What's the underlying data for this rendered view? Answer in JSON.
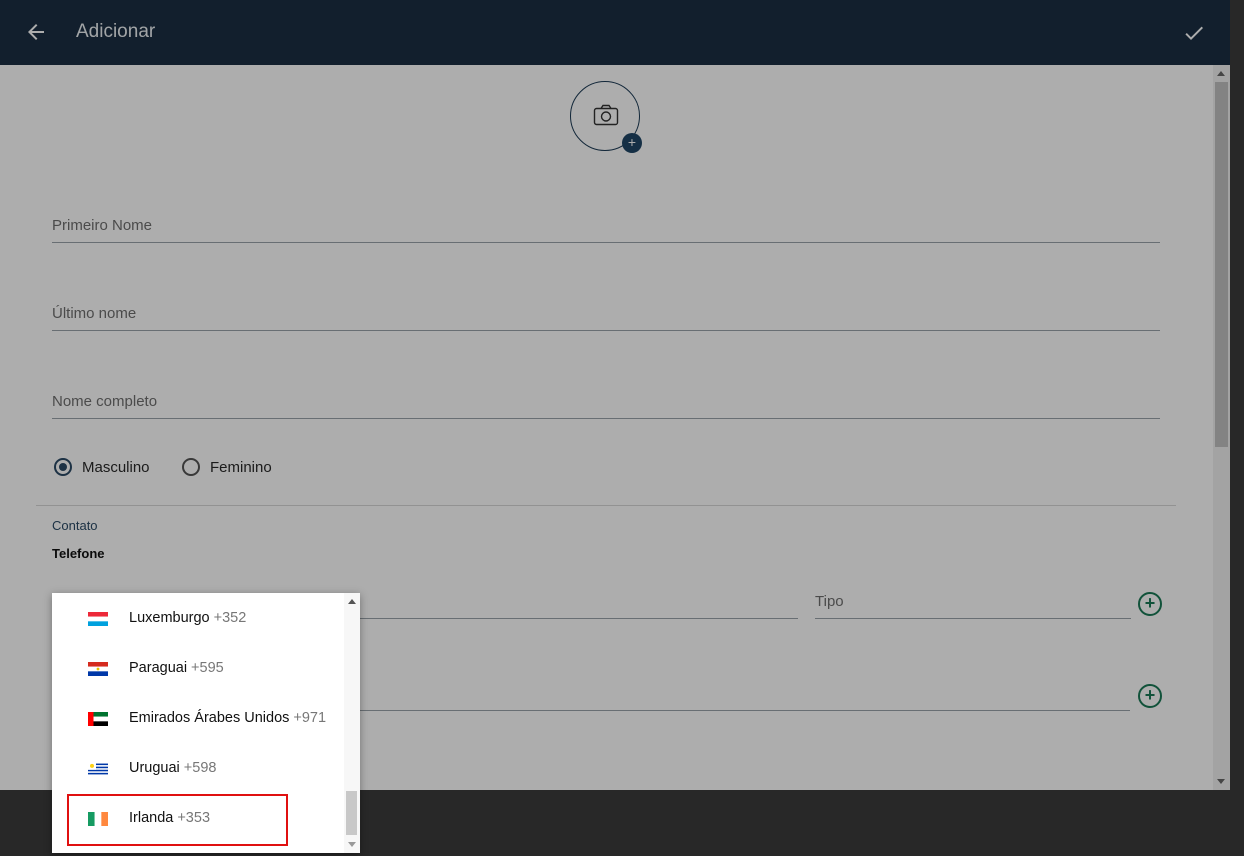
{
  "appbar": {
    "title": "Adicionar"
  },
  "form": {
    "first_name_placeholder": "Primeiro Nome",
    "last_name_placeholder": "Último nome",
    "full_name_placeholder": "Nome completo",
    "gender": {
      "male_label": "Masculino",
      "female_label": "Feminino",
      "selected": "Masculino"
    },
    "contact_section": "Contato",
    "phone_label": "Telefone",
    "type_placeholder": "Tipo"
  },
  "dropdown": {
    "items": [
      {
        "name": "Luxemburgo",
        "code": "+352",
        "flag": "luxembourg-flag"
      },
      {
        "name": "Paraguai",
        "code": "+595",
        "flag": "paraguay-flag"
      },
      {
        "name": "Emirados Árabes Unidos",
        "code": "+971",
        "flag": "uae-flag"
      },
      {
        "name": "Uruguai",
        "code": "+598",
        "flag": "uruguay-flag"
      },
      {
        "name": "Irlanda",
        "code": "+353",
        "flag": "ireland-flag"
      }
    ]
  },
  "colors": {
    "appbar": "#1b2f43",
    "accent": "#2b4a66",
    "add_button": "#1a7a56",
    "highlight": "#e01010"
  }
}
